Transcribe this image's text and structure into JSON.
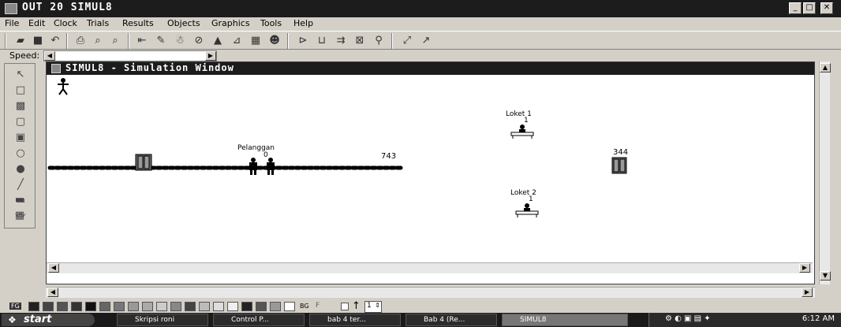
{
  "window": {
    "title": "OUT 20    SIMUL8"
  },
  "menu": [
    "File",
    "Edit",
    "Clock",
    "Trials",
    "Results",
    "Objects",
    "Graphics",
    "Tools",
    "Help"
  ],
  "speed": {
    "label": "Speed:"
  },
  "sim_window": {
    "title": "SIMUL8 - Simulation Window",
    "objects": {
      "queue_label": "Pelanggan",
      "queue_count": "0",
      "entry_count": "743",
      "server1_label": "Loket 1",
      "server1_count": "1",
      "server2_label": "Loket 2",
      "server2_count": "1",
      "exit_count": "344"
    }
  },
  "colorbar": {
    "fg_label": "FG",
    "bg_label": "BG",
    "spinner_value": "1"
  },
  "taskbar": {
    "start": "start",
    "tasks": [
      "Skripsi roni",
      "Control P...",
      "bab 4 ter...",
      "Bab 4 (Re...",
      "SIMUL8"
    ],
    "clock": "6:12 AM"
  }
}
